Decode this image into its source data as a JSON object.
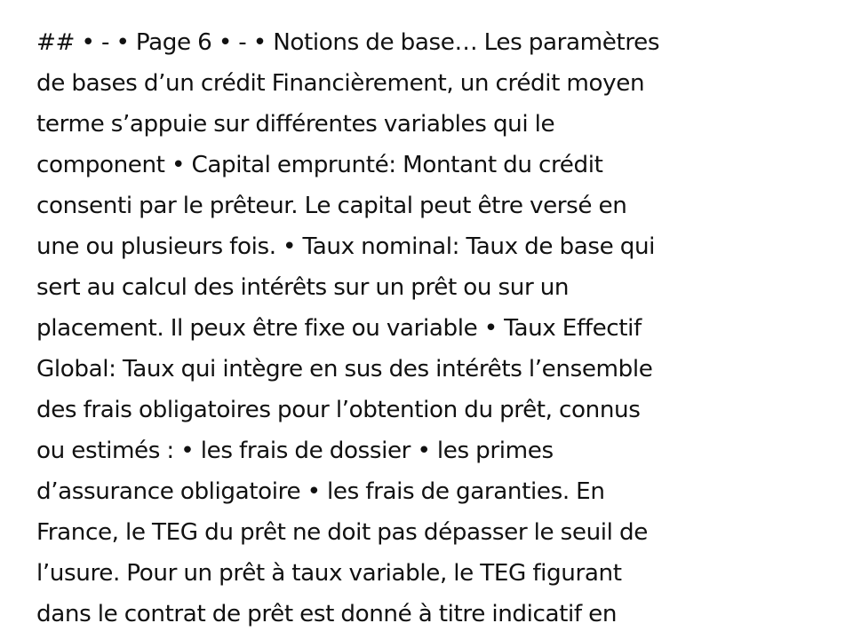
{
  "document": {
    "lines": [
      "## • - • Page 6 • - • Notions de base… Les paramètres",
      "de bases d’un crédit Financièrement, un crédit moyen",
      "terme s’appuie sur différentes variables qui le",
      "component • Capital emprunté: Montant du crédit",
      "consenti par le prêteur. Le capital peut être versé en",
      "une ou plusieurs fois. • Taux nominal: Taux de base qui",
      "sert au calcul des intérêts sur un prêt ou sur un",
      "placement. Il peux être fixe ou variable • Taux Effectif",
      "Global: Taux qui intègre en sus des intérêts l’ensemble",
      "des frais obligatoires pour l’obtention du prêt, connus",
      "ou estimés : • les frais de dossier • les primes",
      "d’assurance obligatoire • les frais de garanties. En",
      "France, le TEG du prêt ne doit pas dépasser le seuil de",
      "l’usure. Pour un prêt à taux variable, le TEG figurant",
      "dans le contrat de prêt est donné à titre indicatif en"
    ]
  }
}
